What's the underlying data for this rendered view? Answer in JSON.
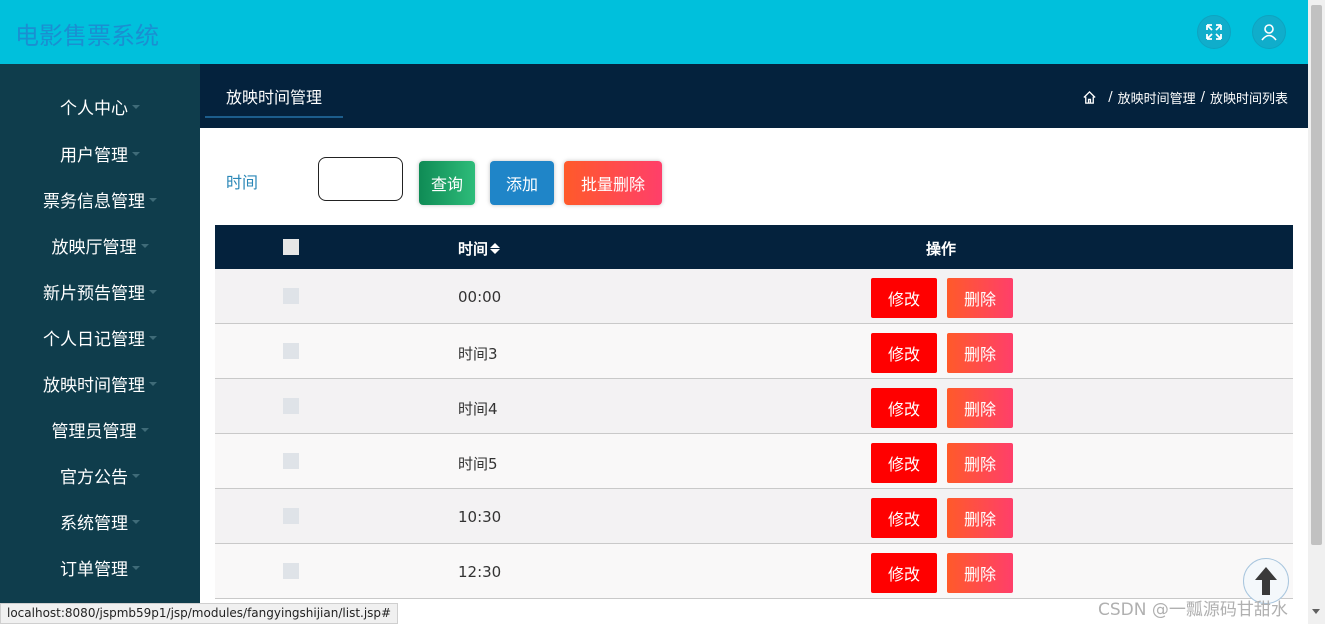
{
  "header": {
    "app_title": "电影售票系统",
    "fullscreen_icon": "fullscreen-icon",
    "user_icon": "user-icon",
    "bg_color": "#00c0dc"
  },
  "sidebar": {
    "items": [
      {
        "label": "个人中心"
      },
      {
        "label": "用户管理"
      },
      {
        "label": "票务信息管理"
      },
      {
        "label": "放映厅管理"
      },
      {
        "label": "新片预告管理"
      },
      {
        "label": "个人日记管理"
      },
      {
        "label": "放映时间管理"
      },
      {
        "label": "管理员管理"
      },
      {
        "label": "官方公告"
      },
      {
        "label": "系统管理"
      },
      {
        "label": "订单管理"
      }
    ]
  },
  "subheader": {
    "tab_label": "放映时间管理",
    "breadcrumb": [
      "放映时间管理",
      "放映时间列表"
    ],
    "separator": "/"
  },
  "search": {
    "label": "时间",
    "value": "",
    "query_label": "查询",
    "add_label": "添加",
    "batch_delete_label": "批量删除"
  },
  "table": {
    "headers": {
      "time": "时间",
      "operations": "操作"
    },
    "rows": [
      {
        "time": "00:00"
      },
      {
        "time": "时间3"
      },
      {
        "time": "时间4"
      },
      {
        "time": "时间5"
      },
      {
        "time": "10:30"
      },
      {
        "time": "12:30"
      }
    ],
    "edit_label": "修改",
    "delete_label": "删除"
  },
  "status_bar": {
    "url": "localhost:8080/jspmb59p1/jsp/modules/fangyingshijian/list.jsp#"
  },
  "watermark": "CSDN @一瓢源码甘甜水"
}
